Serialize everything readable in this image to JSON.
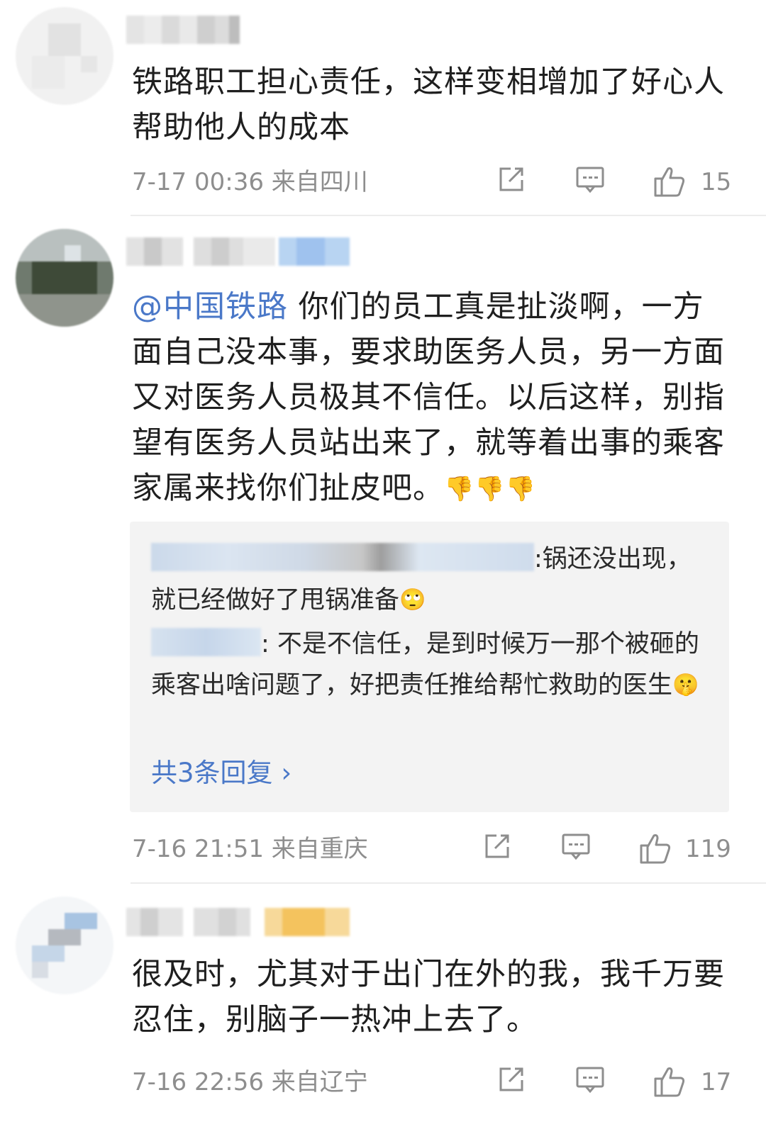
{
  "comments": [
    {
      "text": "铁路职工担心责任，这样变相增加了好心人帮助他人的成本",
      "time": "7-17 00:36",
      "location": "来自四川",
      "likes": "15",
      "avatar_icon": "blurred-avatar",
      "username_blurred": true
    },
    {
      "mention": "@中国铁路",
      "text": " 你们的员工真是扯淡啊，一方面自己没本事，要求助医务人员，另一方面又对医务人员极其不信任。以后这样，别指望有医务人员站出来了，就等着出事的乘客家属来找你们扯皮吧。",
      "emojis": [
        "👎",
        "👎",
        "👎"
      ],
      "time": "7-16 21:51",
      "location": "来自重庆",
      "likes": "119",
      "replies": [
        {
          "text": ":锅还没出现，就已经做好了甩锅准备",
          "emoji": "🙄"
        },
        {
          "text": ": 不是不信任，是到时候万一那个被砸的乘客出啥问题了，好把责任推给帮忙救助的医生",
          "emoji": "🤫"
        }
      ],
      "more_replies": "共3条回复",
      "more_chevron": "›"
    },
    {
      "text": "很及时，尤其对于出门在外的我，我千万要忍住，别脑子一热冲上去了。",
      "time": "7-16 22:56",
      "location": "来自辽宁",
      "likes": "17"
    }
  ],
  "icons": {
    "share": "share-icon",
    "comment": "comment-icon",
    "like": "thumbs-up-icon"
  },
  "colors": {
    "mention": "#4a78c8",
    "meta": "#8e8e8e",
    "reply_bg": "#f3f3f3"
  }
}
